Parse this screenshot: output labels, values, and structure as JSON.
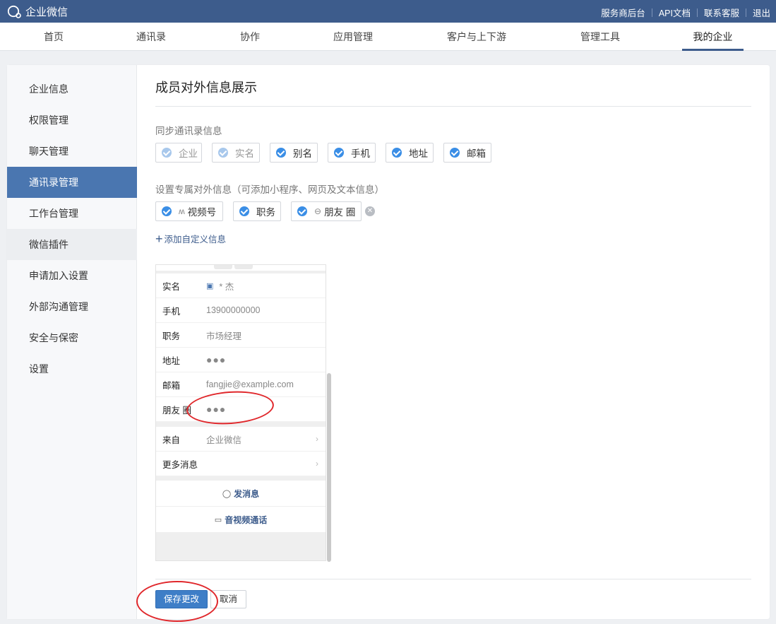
{
  "app": {
    "title": "企业微信"
  },
  "toplinks": [
    "服务商后台",
    "API文档",
    "联系客服",
    "退出"
  ],
  "nav": [
    "首页",
    "通讯录",
    "协作",
    "应用管理",
    "客户与上下游",
    "管理工具",
    "我的企业"
  ],
  "nav_active": "我的企业",
  "sidebar": [
    "企业信息",
    "权限管理",
    "聊天管理",
    "通讯录管理",
    "工作台管理",
    "微信插件",
    "申请加入设置",
    "外部沟通管理",
    "安全与保密",
    "设置"
  ],
  "sidebar_active": "通讯录管理",
  "page": {
    "title": "成员对外信息展示",
    "sync_label": "同步通讯录信息",
    "sync_fields": [
      {
        "label": "企业",
        "disabled": true
      },
      {
        "label": "实名",
        "disabled": true
      },
      {
        "label": "别名",
        "disabled": false
      },
      {
        "label": "手机",
        "disabled": false
      },
      {
        "label": "地址",
        "disabled": false
      },
      {
        "label": "邮箱",
        "disabled": false
      }
    ],
    "custom_label": "设置专属对外信息（可添加小程序、网页及文本信息）",
    "custom_fields": [
      {
        "label": "视频号",
        "icon": "ʍ"
      },
      {
        "label": "职务",
        "icon": ""
      },
      {
        "label": "朋友 圈",
        "icon": "⊖"
      }
    ],
    "add_custom": "添加自定义信息"
  },
  "preview": {
    "rows": [
      {
        "k": "实名",
        "v": "* 杰"
      },
      {
        "k": "手机",
        "v": "13900000000"
      },
      {
        "k": "职务",
        "v": "市场经理"
      },
      {
        "k": "地址",
        "v": "●●●"
      },
      {
        "k": "邮箱",
        "v": "fangjie@example.com"
      },
      {
        "k": "朋友 圈",
        "v": "●●●"
      }
    ],
    "links": [
      {
        "k": "来自",
        "v": "企业微信"
      },
      {
        "k": "更多消息",
        "v": ""
      }
    ],
    "send_msg": "发消息",
    "av_call": "音视频通话"
  },
  "buttons": {
    "save": "保存更改",
    "cancel": "取消"
  },
  "colors": {
    "topbar": "#3d5c8c",
    "accent": "#4a76b0",
    "check": "#3a8ee6",
    "annotation": "#e0272b"
  }
}
